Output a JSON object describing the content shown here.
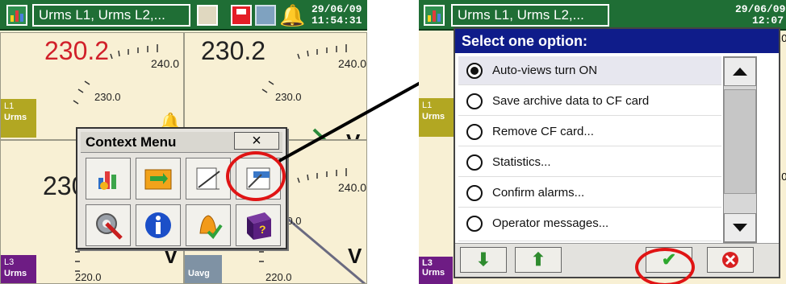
{
  "left": {
    "title": "Urms L1, Urms L2,...",
    "date": "29/06/09",
    "time": "11:54:31",
    "quads": {
      "q1": {
        "value": "230.2",
        "scale_hi": "240.0",
        "scale_mid": "230.0",
        "chip_line": "L1",
        "chip_label": "Urms"
      },
      "q2": {
        "value": "230.2",
        "scale_hi": "240.0",
        "scale_mid": "230.0",
        "unit": "V"
      },
      "q3": {
        "value": "230",
        "scale_lo": "220.0",
        "chip_line": "L3",
        "chip_label": "Urms",
        "unit": "V"
      },
      "q4": {
        "value": "",
        "scale_hi": "240.0",
        "scale_mid": "230.0",
        "scale_lo": "220.0",
        "chip_label": "Uavg",
        "unit": "V"
      }
    },
    "context_menu": {
      "title": "Context Menu",
      "close": "×",
      "icons": [
        "chart-icon",
        "refresh-icon",
        "notepad-icon",
        "window-icon",
        "settings-icon",
        "info-icon",
        "alarm-icon",
        "help-book-icon"
      ]
    }
  },
  "right": {
    "title": "Urms L1, Urms L2,...",
    "date": "29/06/09",
    "time": "12:07",
    "dialog": {
      "title": "Select one option:",
      "options": [
        "Auto-views turn ON",
        "Save archive data to CF card",
        "Remove CF card...",
        "Statistics...",
        "Confirm alarms...",
        "Operator messages..."
      ]
    },
    "behind": {
      "q1_chip_line": "L1",
      "q1_chip_label": "Urms",
      "q3_chip_line": "L3",
      "q3_chip_label": "Urms",
      "q4_chip_label": "Uavg",
      "scale_hi": "240.0",
      "scale_lo": "220.0",
      "unit": "V"
    }
  },
  "colors": {
    "topbar": "#1f6e35",
    "highlight": "#e01414",
    "dialog_title": "#0f1c8a"
  }
}
